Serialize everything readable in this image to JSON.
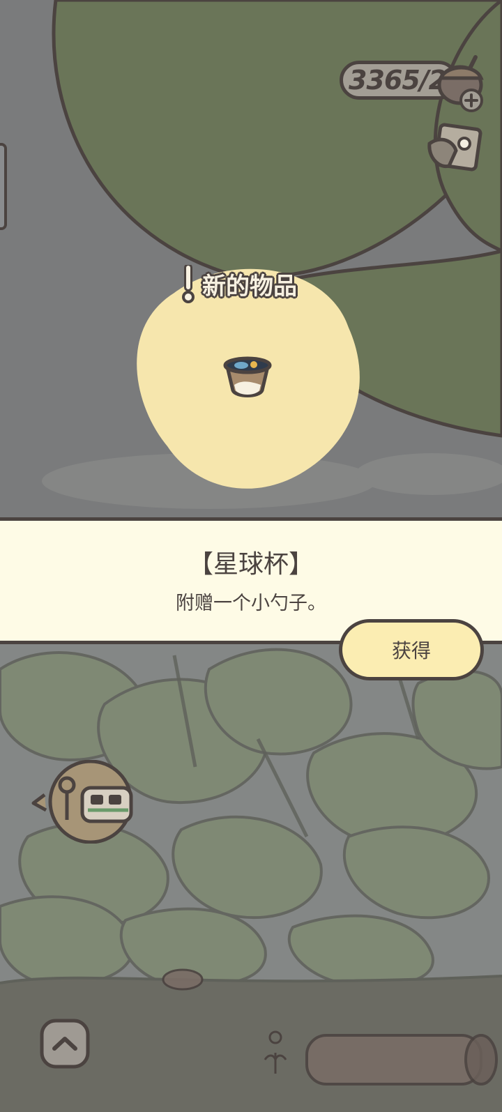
{
  "hud": {
    "clover_count": "3365/2",
    "acorn_icon": "acorn-icon",
    "add_icon": "plus-icon",
    "camera_icon": "camera-icon"
  },
  "notification": {
    "new_item_label": "新的物品",
    "marker_icon": "exclamation-icon"
  },
  "item": {
    "icon": "cup-icon",
    "name": "【星球杯】",
    "description": "附赠一个小勺子。"
  },
  "actions": {
    "get_label": "获得",
    "expand_icon": "chevron-up-icon",
    "ticket_icon": "ticket-icon"
  },
  "colors": {
    "outline": "#4b4340",
    "leaf": "#6a7558",
    "spotlight": "#f6e6ad",
    "panel": "#fefbe6",
    "button": "#fbedb2"
  }
}
